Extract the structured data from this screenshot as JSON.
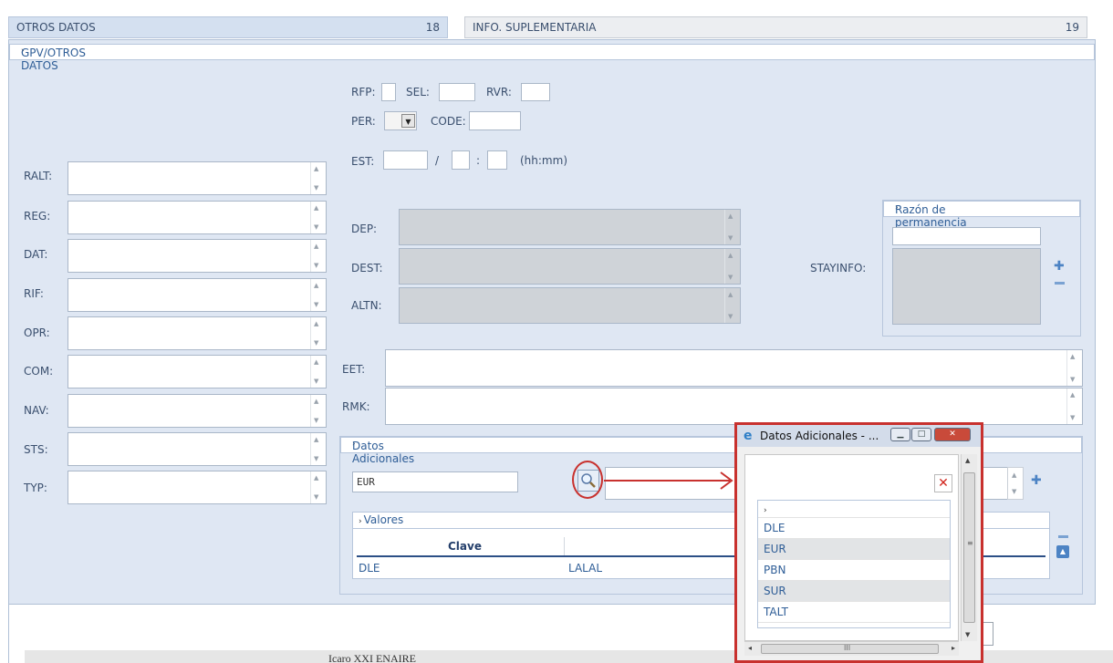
{
  "tabs": [
    {
      "label": "OTROS DATOS",
      "count": "18"
    },
    {
      "label": "INFO. SUPLEMENTARIA",
      "count": "19"
    }
  ],
  "section_gpv": {
    "title": "GPV/OTROS DATOS"
  },
  "left_fields": [
    {
      "label": "RALT:"
    },
    {
      "label": "REG:"
    },
    {
      "label": "DAT:"
    },
    {
      "label": "RIF:"
    },
    {
      "label": "OPR:"
    },
    {
      "label": "COM:"
    },
    {
      "label": "NAV:"
    },
    {
      "label": "STS:"
    },
    {
      "label": "TYP:"
    }
  ],
  "top_fields": {
    "rfp": "RFP:",
    "sel": "SEL:",
    "rvr": "RVR:",
    "per": "PER:",
    "code": "CODE:",
    "est": "EST:",
    "slash": "/",
    "colon": ":",
    "hhmm": "(hh:mm)"
  },
  "mid_fields": [
    {
      "label": "DEP:"
    },
    {
      "label": "DEST:"
    },
    {
      "label": "ALTN:"
    }
  ],
  "stayinfo": {
    "label": "STAYINFO:",
    "section_title": "Razón de permanencia"
  },
  "eet": {
    "label": "EET:"
  },
  "rmk": {
    "label": "RMK:"
  },
  "datos_adicionales": {
    "title": "Datos Adicionales",
    "input_value": "EUR",
    "valores_title": "Valores",
    "columns": [
      "Clave",
      ""
    ],
    "rows": [
      {
        "clave": "DLE",
        "valor": "LALAL"
      }
    ]
  },
  "popup": {
    "title": "Datos Adicionales - ...",
    "items": [
      "DLE",
      "EUR",
      "PBN",
      "SUR",
      "TALT"
    ],
    "scroll_mark": "III"
  },
  "footer": {
    "text": "Icaro XXI ENAIRE"
  },
  "colors": {
    "accent": "#2f5e97",
    "panel": "#dfe7f3",
    "annotation": "#c8312e"
  }
}
